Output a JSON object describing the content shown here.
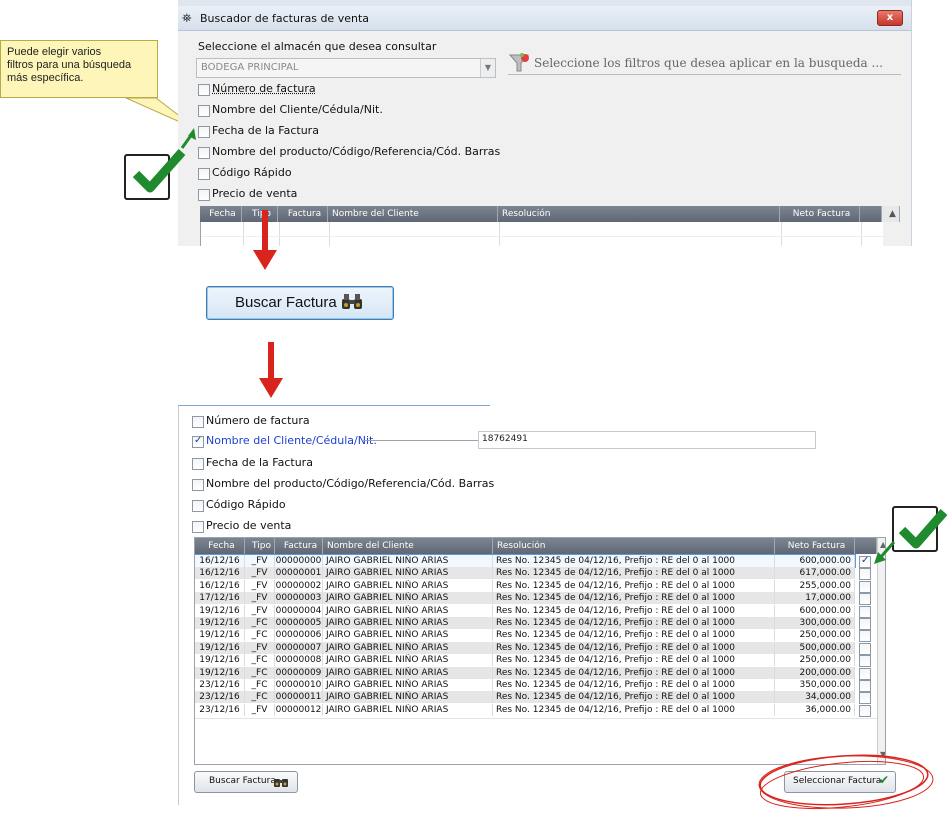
{
  "callout_text": [
    "Puede elegir varios",
    "filtros para una búsqueda",
    "más específica."
  ],
  "window": {
    "title": "Buscador de facturas de venta",
    "close_label": "x",
    "warehouse_prompt": "Seleccione el almacén que desea consultar",
    "warehouse_value": "BODEGA PRINCIPAL",
    "filter_hint": "Seleccione los filtros que desea aplicar en la busqueda ..."
  },
  "filters": [
    {
      "label": "Número de factura",
      "checked": false
    },
    {
      "label": "Nombre del Cliente/Cédula/Nit.",
      "checked": false
    },
    {
      "label": "Fecha de la Factura",
      "checked": false
    },
    {
      "label": "Nombre del producto/Código/Referencia/Cód. Barras",
      "checked": false
    },
    {
      "label": "Código Rápido",
      "checked": false
    },
    {
      "label": "Precio de venta",
      "checked": false
    }
  ],
  "grid_columns": [
    "Fecha",
    "Tipo",
    "Factura",
    "Nombre del Cliente",
    "Resolución",
    "Neto Factura"
  ],
  "search_button_label": "Buscar Factura",
  "lower": {
    "filters": [
      {
        "label": "Número de factura",
        "checked": false
      },
      {
        "label": "Nombre del Cliente/Cédula/Nit.",
        "checked": true
      },
      {
        "label": "Fecha de la Factura",
        "checked": false
      },
      {
        "label": "Nombre del producto/Código/Referencia/Cód. Barras",
        "checked": false
      },
      {
        "label": "Código Rápido",
        "checked": false
      },
      {
        "label": "Precio de venta",
        "checked": false
      }
    ],
    "client_filter_value": "18762491",
    "rows": [
      [
        "16/12/16",
        "_FV",
        "00000000",
        "JAIRO GABRIEL NIÑO ARIAS",
        "Res No. 12345 de 04/12/16, Prefijo : RE del 0 al 1000",
        "600,000.00",
        true
      ],
      [
        "16/12/16",
        "_FV",
        "00000001",
        "JAIRO GABRIEL NIÑO ARIAS",
        "Res No. 12345 de 04/12/16, Prefijo : RE del 0 al 1000",
        "617,000.00",
        false
      ],
      [
        "16/12/16",
        "_FV",
        "00000002",
        "JAIRO GABRIEL NIÑO ARIAS",
        "Res No. 12345 de 04/12/16, Prefijo : RE del 0 al 1000",
        "255,000.00",
        false
      ],
      [
        "17/12/16",
        "_FV",
        "00000003",
        "JAIRO GABRIEL NIÑO ARIAS",
        "Res No. 12345 de 04/12/16, Prefijo : RE del 0 al 1000",
        "17,000.00",
        false
      ],
      [
        "19/12/16",
        "_FV",
        "00000004",
        "JAIRO GABRIEL NIÑO ARIAS",
        "Res No. 12345 de 04/12/16, Prefijo : RE del 0 al 1000",
        "600,000.00",
        false
      ],
      [
        "19/12/16",
        "_FC",
        "00000005",
        "JAIRO GABRIEL NIÑO ARIAS",
        "Res No. 12345 de 04/12/16, Prefijo : RE del 0 al 1000",
        "300,000.00",
        false
      ],
      [
        "19/12/16",
        "_FC",
        "00000006",
        "JAIRO GABRIEL NIÑO ARIAS",
        "Res No. 12345 de 04/12/16, Prefijo : RE del 0 al 1000",
        "250,000.00",
        false
      ],
      [
        "19/12/16",
        "_FV",
        "00000007",
        "JAIRO GABRIEL NIÑO ARIAS",
        "Res No. 12345 de 04/12/16, Prefijo : RE del 0 al 1000",
        "500,000.00",
        false
      ],
      [
        "19/12/16",
        "_FC",
        "00000008",
        "JAIRO GABRIEL NIÑO ARIAS",
        "Res No. 12345 de 04/12/16, Prefijo : RE del 0 al 1000",
        "250,000.00",
        false
      ],
      [
        "19/12/16",
        "_FC",
        "00000009",
        "JAIRO GABRIEL NIÑO ARIAS",
        "Res No. 12345 de 04/12/16, Prefijo : RE del 0 al 1000",
        "200,000.00",
        false
      ],
      [
        "23/12/16",
        "_FC",
        "00000010",
        "JAIRO GABRIEL NIÑO ARIAS",
        "Res No. 12345 de 04/12/16, Prefijo : RE del 0 al 1000",
        "350,000.00",
        false
      ],
      [
        "23/12/16",
        "_FC",
        "00000011",
        "JAIRO GABRIEL NIÑO ARIAS",
        "Res No. 12345 de 04/12/16, Prefijo : RE del 0 al 1000",
        "34,000.00",
        false
      ],
      [
        "23/12/16",
        "_FV",
        "00000012",
        "JAIRO GABRIEL NIÑO ARIAS",
        "Res No. 12345 de 04/12/16, Prefijo : RE del 0 al 1000",
        "36,000.00",
        false
      ]
    ],
    "bottom_search_label": "Buscar Factura",
    "select_button_label": "Seleccionar Factura"
  },
  "colors": {
    "accent_arrow": "#d9231d",
    "check_green": "#1f8a2e",
    "label_blue": "#1d3fcf",
    "ellipse_red": "#d9231d"
  }
}
